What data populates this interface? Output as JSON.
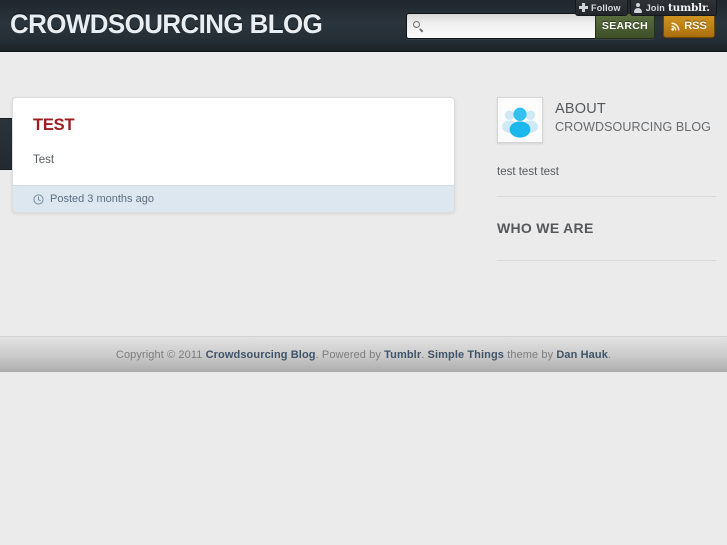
{
  "tumblr_bar": {
    "follow_label": "Follow",
    "join_label": "Join",
    "brand_label": "tumblr.",
    "follow_icon": "plus-icon",
    "join_icon": "person-icon"
  },
  "header": {
    "blog_title": "CROWDSOURCING BLOG",
    "search": {
      "value": "",
      "placeholder": "",
      "icon": "search-icon",
      "button_label": "SEARCH",
      "button_color": "#4a5c33"
    },
    "rss": {
      "label": "RSS",
      "icon": "rss-icon",
      "color": "#bd8017"
    },
    "background_color": "#222b33"
  },
  "post": {
    "title": "TEST",
    "title_color": "#9c1c20",
    "body": "Test",
    "meta_icon": "clock-icon",
    "meta_text": "Posted 3 months ago",
    "meta_background": "#dde7f0"
  },
  "sidebar": {
    "about": {
      "heading": "ABOUT",
      "subtitle": "CROWDSOURCING BLOG",
      "description": "test test test",
      "avatar_icon": "default-avatar-icon"
    },
    "sections": [
      {
        "heading": "WHO WE ARE"
      }
    ]
  },
  "footer": {
    "copyright_prefix": "Copyright © 2011 ",
    "blog_link": "Crowdsourcing Blog",
    "powered_prefix": ". Powered by ",
    "tumblr_link": "Tumblr",
    "theme_separator": ". ",
    "theme_link": "Simple Things",
    "theme_by": " theme by ",
    "author_link": "Dan Hauk",
    "period": "."
  }
}
